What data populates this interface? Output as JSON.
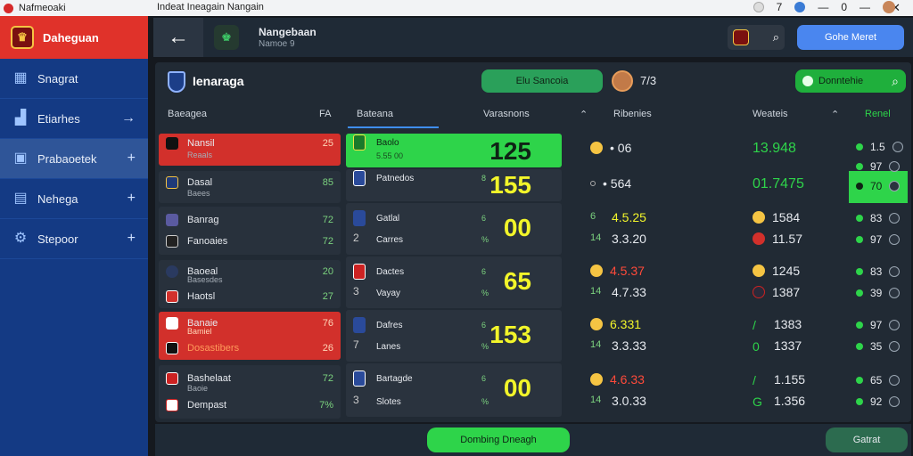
{
  "window": {
    "app_title": "Nafmeoaki",
    "center_title": "Indeat Ineagain Nangain",
    "right_count_a": "7",
    "right_count_b": "0"
  },
  "sidebar": {
    "brand": "Daheguan",
    "items": [
      {
        "label": "Snagrat",
        "icon": "grid-icon",
        "action": ""
      },
      {
        "label": "Etiarhes",
        "icon": "chart-icon",
        "action": "→"
      },
      {
        "label": "Prabaoetek",
        "icon": "ticket-icon",
        "action": "+"
      },
      {
        "label": "Nehega",
        "icon": "table-icon",
        "action": "+"
      },
      {
        "label": "Stepoor",
        "icon": "gear-icon",
        "action": "+"
      }
    ]
  },
  "topbar": {
    "title": "Nangebaan",
    "subtitle": "Namoe 9",
    "button": "Gohe Meret"
  },
  "panel": {
    "league": "Ienaraga",
    "pill": "Elu Sancoia",
    "user_count": "7/3",
    "search_label": "Donntehie"
  },
  "headers": {
    "c1": "Baeagea",
    "c1b": "FA",
    "c2": "Bateana",
    "c3": "Varasnons",
    "c4": "Ribenies",
    "c5": "Weateis",
    "c6": "Renel"
  },
  "left_rows": [
    {
      "a": "Nansil",
      "b": "Reaals",
      "pt": "25"
    },
    {
      "a": "Dasal",
      "b": "Baees",
      "pt": "85"
    },
    {
      "a": "Banrag",
      "b": "Fanoaies",
      "pt": "72",
      "pt2": "72"
    },
    {
      "a": "Baoeal",
      "b": "Basesdes",
      "c": "Haotsl",
      "pt": "20",
      "pt2": "27"
    },
    {
      "a": "Banaie",
      "b": "Bamiel",
      "c": "Dosastibers",
      "pt": "76",
      "pt2": "26"
    },
    {
      "a": "Bashelaat",
      "b": "Baoie",
      "c": "Dempast",
      "pt": "72",
      "pt2": "7%"
    }
  ],
  "mid_rows": [
    {
      "a": "Baolo",
      "b": "5.55 00",
      "big": "125"
    },
    {
      "a": "Patnedos",
      "b": "",
      "big": "155",
      "sm": "8"
    },
    {
      "a": "Gatlal",
      "b": "Carres",
      "big": "00",
      "sm": "6",
      "sm2": "%",
      "num": "2"
    },
    {
      "a": "Dactes",
      "b": "Vayay",
      "big": "65",
      "sm": "6",
      "sm2": "%",
      "num": "3"
    },
    {
      "a": "Dafres",
      "b": "Lanes",
      "big": "153",
      "sm": "6",
      "sm2": "%",
      "num": "7"
    },
    {
      "a": "Bartagde",
      "b": "Slotes",
      "big": "00",
      "sm": "6",
      "sm2": "%",
      "num": "3"
    }
  ],
  "right_block": [
    {
      "a": "• 06",
      "b": "13.948",
      "c": "1.5",
      "d": "97"
    },
    {
      "a": "• 564",
      "b": "01.7475",
      "c": "70"
    },
    {
      "a": "4.5.25",
      "a2": "3.3.20",
      "b": "1584",
      "b2": "11.57",
      "c": "83",
      "c2": "97"
    },
    {
      "a": "4.5.37",
      "a2": "4.7.33",
      "b": "1245",
      "b2": "1387",
      "c": "83",
      "c2": "39"
    },
    {
      "a": "6.331",
      "a2": "3.3.33",
      "b": "1383",
      "b2": "1337",
      "c": "97",
      "c2": "35"
    },
    {
      "a": "4.6.33",
      "a2": "3.0.33",
      "b": "1.155",
      "b2": "1.356",
      "c": "65",
      "c2": "92"
    }
  ],
  "bottom": {
    "primary": "Dombing Dneagh",
    "secondary": "Gatrat"
  }
}
